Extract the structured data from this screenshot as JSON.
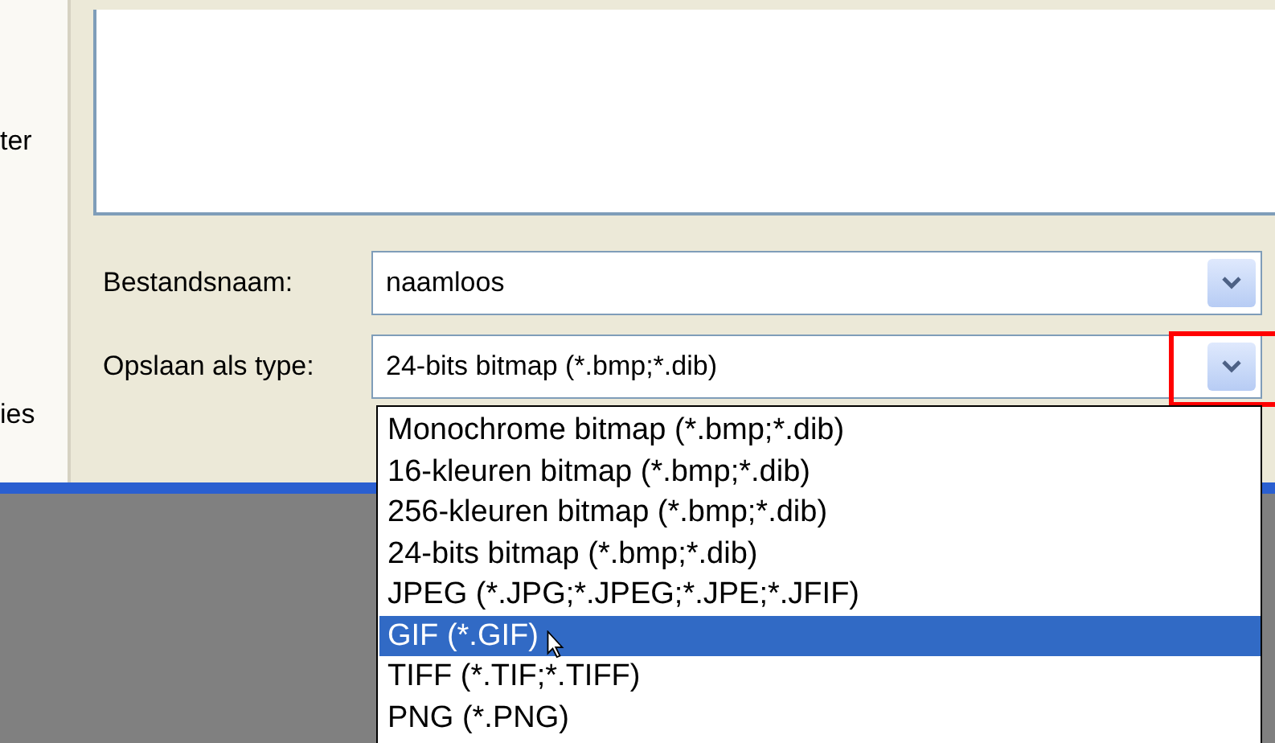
{
  "sidebar": {
    "items": [
      {
        "label": "ter"
      },
      {
        "label": "ies"
      }
    ]
  },
  "fields": [
    {
      "label": "Bestandsnaam:",
      "value": "naamloos"
    },
    {
      "label": "Opslaan als type:",
      "value": "24-bits bitmap (*.bmp;*.dib)",
      "expanded": true
    }
  ],
  "dropdown": {
    "options": [
      {
        "label": "Monochrome bitmap (*.bmp;*.dib)",
        "selected": false
      },
      {
        "label": "16-kleuren bitmap (*.bmp;*.dib)",
        "selected": false
      },
      {
        "label": "256-kleuren bitmap (*.bmp;*.dib)",
        "selected": false
      },
      {
        "label": "24-bits bitmap (*.bmp;*.dib)",
        "selected": false
      },
      {
        "label": "JPEG (*.JPG;*.JPEG;*.JPE;*.JFIF)",
        "selected": false
      },
      {
        "label": "GIF (*.GIF)",
        "selected": true
      },
      {
        "label": "TIFF (*.TIF;*.TIFF)",
        "selected": false
      },
      {
        "label": "PNG (*.PNG)",
        "selected": false
      }
    ]
  }
}
